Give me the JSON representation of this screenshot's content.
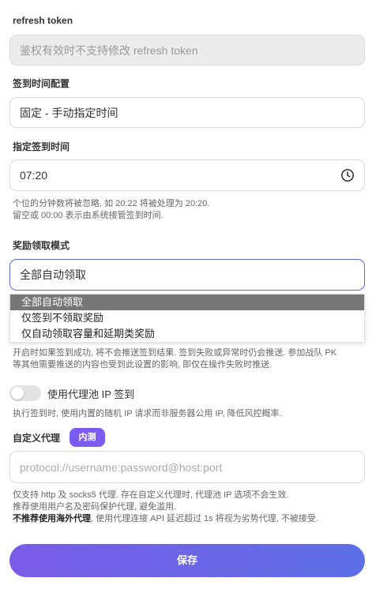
{
  "refresh_token": {
    "label": "refresh token",
    "placeholder": "鉴权有效时不支持修改 refresh token"
  },
  "checkin_config": {
    "label": "签到时间配置",
    "value": "固定 - 手动指定时间"
  },
  "checkin_time": {
    "label": "指定签到时间",
    "value": "07:20",
    "icon": "clock-icon",
    "hint_line1": "个位的分钟数将被忽略, 如 20:22 将被处理为 20:20.",
    "hint_line2": "留空或 00:00 表示由系统接管签到时间."
  },
  "reward_mode": {
    "label": "奖励领取模式",
    "value": "全部自动领取",
    "options": [
      "全部自动领取",
      "仅签到不领取奖励",
      "仅自动领取容量和延期类奖励"
    ],
    "selected_index": 0,
    "hint_line1": "开启时如果签到成功, 将不会推送签到结果. 签到失败或异常时仍会推送. 参加战队 PK",
    "hint_line2": "等其他需要推送的内容也受到此设置的影响, 即仅在操作失败时推送."
  },
  "proxy_pool": {
    "label": "使用代理池 IP 签到",
    "enabled": false,
    "hint": "执行签到时, 使用内置的随机 IP 请求而非服务器公用 IP, 降低风控概率."
  },
  "custom_proxy": {
    "label": "自定义代理",
    "badge": "内测",
    "placeholder": "protocol://username:password@host:port",
    "hint_line1": "仅支持 http 及 socks5 代理. 存在自定义代理时, 代理池 IP 选项不会生效.",
    "hint_line2": "推荐使用用户名及密码保护代理, 避免滥用.",
    "hint_line3_bold": "不推荐使用海外代理",
    "hint_line3_rest": ", 使用代理连接 API 延迟超过 1s 将视为劣势代理, 不被接受."
  },
  "save_label": "保存",
  "colors": {
    "accent_start": "#7b5ce8",
    "accent_end": "#5d6fe6",
    "badge": "#7a5cf0",
    "focus_border": "#5b6bd6"
  }
}
